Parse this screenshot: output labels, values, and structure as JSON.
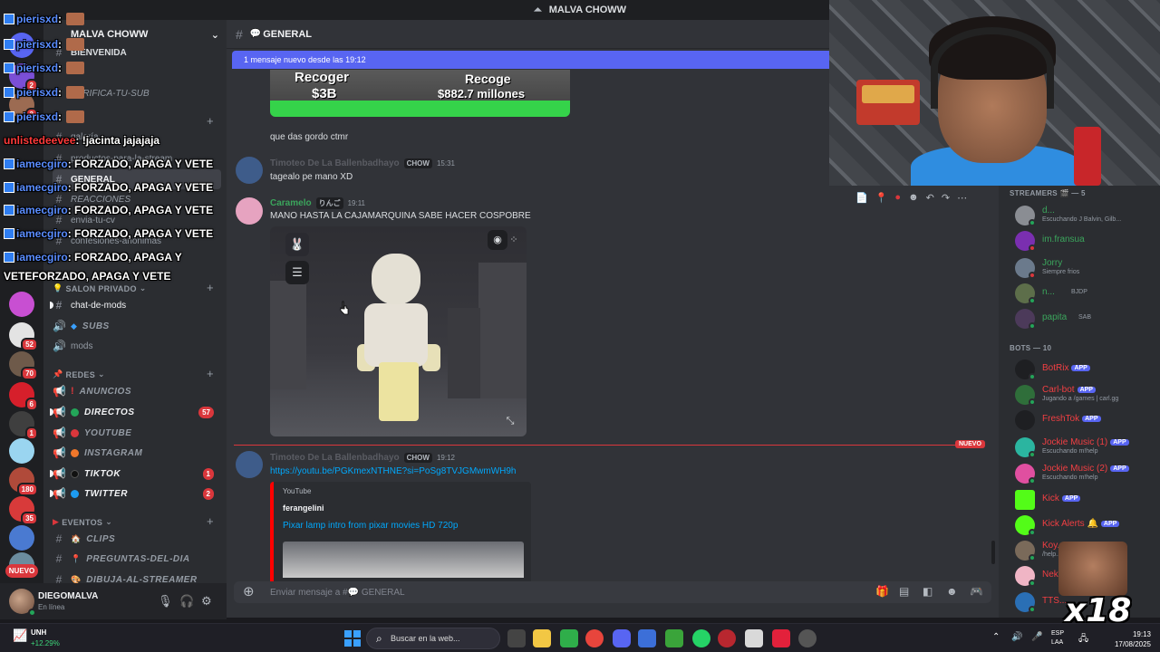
{
  "titlebar": {
    "icon": "discord-logo-icon",
    "title": "MALVA CHOWW"
  },
  "server": {
    "name": "MALVA CHOWW"
  },
  "sidebar": {
    "channels_top": [
      {
        "label": "BIENVENIDA"
      },
      {
        "label": "VERIFICA-TU-SUB"
      },
      {
        "label": "galería"
      },
      {
        "label": "productos-para-la-stream"
      },
      {
        "label": "GENERAL"
      },
      {
        "label": "REACCIONES"
      },
      {
        "label": "envia-tu-cv"
      },
      {
        "label": "confesiones-anónimas"
      }
    ],
    "cat_privado": "SALON PRIVADO",
    "privado_channels": [
      {
        "label": "chat-de-mods"
      },
      {
        "label": "SUBS"
      },
      {
        "label": "mods"
      }
    ],
    "cat_redes": "REDES",
    "redes_channels": [
      {
        "label": "ANUNCIOS"
      },
      {
        "label": "DIRECTOS",
        "badge": "57"
      },
      {
        "label": "YOUTUBE"
      },
      {
        "label": "INSTAGRAM"
      },
      {
        "label": "TIKTOK",
        "badge": "1"
      },
      {
        "label": "TWITTER",
        "badge": "2"
      }
    ],
    "cat_eventos": "EVENTOS",
    "eventos_channels": [
      {
        "label": "CLIPS"
      },
      {
        "label": "PREGUNTAS-DEL-DIA"
      },
      {
        "label": "DIBUJA-AL-STREAMER"
      }
    ]
  },
  "rail": {
    "badges": [
      "2",
      "2",
      "52",
      "70",
      "6",
      "1",
      "180",
      "35"
    ],
    "new_pill": "NUEVO"
  },
  "user": {
    "name": "DIEGOMALVA",
    "status": "En línea"
  },
  "chat": {
    "channel": "GENERAL",
    "new_banner": "1 mensaje nuevo desde las 19:12",
    "game_text": {
      "a": "Recoger",
      "b": "$3B",
      "c": "Recoge",
      "d": "$882.7 millones"
    },
    "msg1": "que das gordo ctmr",
    "msg2_author": "Timoteo De La Ballenbadhayo",
    "msg2_tag": "CHOW",
    "msg2_time": "15:31",
    "msg2_text": "tagealo pe mano XD",
    "msg3_author": "Caramelo",
    "msg3_tag": "りんご",
    "msg3_time": "19:11",
    "msg3_text": "MANO HASTA LA CAJAMARQUINA SABE HACER COSPOBRE",
    "divider": "NUEVO",
    "msg4_author": "Timoteo De La Ballenbadhayo",
    "msg4_tag": "CHOW",
    "msg4_time": "19:12",
    "msg4_link": "https://youtu.be/PGKmexNTHNE?si=PoSg8TVJGMwmWH9h",
    "yt": {
      "provider": "YouTube",
      "author": "ferangelini",
      "title": "Pixar lamp intro from pixar movies HD 720p"
    },
    "composer_placeholder": "Enviar mensaje a #💬 GENERAL"
  },
  "members": {
    "cat_streamers": "STREAMERS 🎬 — 5",
    "streamers": [
      {
        "name": "d...",
        "sub": "Escuchando J Balvin, Gilb..."
      },
      {
        "name": "im.fransua",
        "sub": ""
      },
      {
        "name": "Jorry",
        "sub": "Siempre frios"
      },
      {
        "name": "n...",
        "sub": "BJDP"
      },
      {
        "name": "papita",
        "sub": "SAB"
      }
    ],
    "cat_bots": "BOTS — 10",
    "bots": [
      {
        "name": "BotRix",
        "tag": "APP",
        "sub": ""
      },
      {
        "name": "Carl-bot",
        "tag": "APP",
        "sub": "Jugando a /games | carl.gg"
      },
      {
        "name": "FreshTok",
        "tag": "APP",
        "sub": ""
      },
      {
        "name": "Jockie Music (1)",
        "tag": "APP",
        "sub": "Escuchando m!help"
      },
      {
        "name": "Jockie Music (2)",
        "tag": "APP",
        "sub": "Escuchando m!help"
      },
      {
        "name": "Kick",
        "tag": "APP",
        "sub": ""
      },
      {
        "name": "Kick Alerts 🔔",
        "tag": "APP",
        "sub": ""
      },
      {
        "name": "Koy...",
        "tag": "",
        "sub": "/help..."
      },
      {
        "name": "Nek...",
        "tag": "",
        "sub": ""
      },
      {
        "name": "TTS...",
        "tag": "",
        "sub": ""
      }
    ]
  },
  "twitch_chat": [
    {
      "user": "pierisxd",
      "msg": ""
    },
    {
      "user": "pierisxd",
      "msg": ""
    },
    {
      "user": "pierisxd",
      "msg": ""
    },
    {
      "user": "pierisxd",
      "msg": ""
    },
    {
      "user": "pierisxd",
      "msg": ""
    },
    {
      "user": "unlistedeevee",
      "msg": "!jacinta jajajaja"
    },
    {
      "user": "iamecgiro",
      "msg": "FORZADO, APAGA Y VETE"
    },
    {
      "user": "iamecgiro",
      "msg": "FORZADO, APAGA Y VETE"
    },
    {
      "user": "iamecgiro",
      "msg": "FORZADO, APAGA Y VETE"
    },
    {
      "user": "iamecgiro",
      "msg": "FORZADO, APAGA Y VETE"
    },
    {
      "user": "iamecgiro",
      "msg": "FORZADO, APAGA Y"
    },
    {
      "user": "",
      "msg": "VETEFORZADO, APAGA Y VETE"
    }
  ],
  "emote": {
    "label": "x18"
  },
  "taskbar": {
    "ticker_name": "UNH",
    "ticker_val": "+12.29%",
    "search": "Buscar en la web...",
    "lang1": "ESP",
    "lang2": "LAA",
    "time": "19:13",
    "date": "17/08/2025"
  }
}
